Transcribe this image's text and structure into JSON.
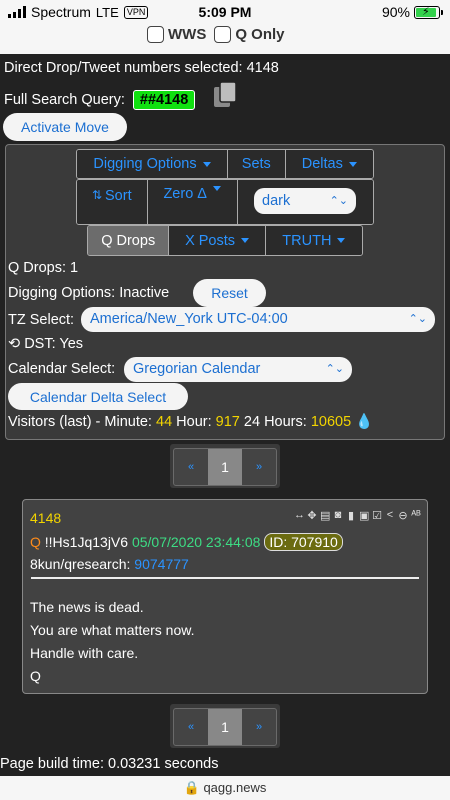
{
  "status": {
    "carrier": "Spectrum",
    "network": "LTE",
    "vpn": "VPN",
    "time": "5:09 PM",
    "battery": "90%",
    "battery_level": 0.9
  },
  "filters": {
    "wws": "WWS",
    "q_only": "Q Only"
  },
  "selection": {
    "text": "Direct Drop/Tweet numbers selected: 4148",
    "query_label": "Full Search Query:",
    "query_value": "##4148",
    "activate_move": "Activate Move"
  },
  "toolbar": {
    "digging": "Digging Options",
    "sets": "Sets",
    "deltas": "Deltas",
    "sort": "Sort",
    "zero": "Zero Δ",
    "theme": "dark",
    "q_drops": "Q Drops",
    "x_posts": "X Posts",
    "truth": "TRUTH"
  },
  "info": {
    "q_drops_count": "Q Drops: 1",
    "digging_status": "Digging Options: Inactive",
    "reset": "Reset",
    "tz_label": "TZ Select:",
    "tz_value": "America/New_York UTC-04:00",
    "dst": "DST: Yes",
    "calendar_label": "Calendar Select:",
    "calendar_value": "Gregorian Calendar",
    "calendar_delta": "Calendar Delta Select",
    "visitors_label": "Visitors (last) - Minute:",
    "minute": "44",
    "hour_label": "Hour:",
    "hour": "917",
    "day_label": "24 Hours:",
    "day": "10605"
  },
  "pagination": {
    "prev": "«",
    "current": "1",
    "next": "»"
  },
  "drop": {
    "number": "4148",
    "q": "Q",
    "trip": "!!Hs1Jq13jV6",
    "datetime": "05/07/2020 23:44:08",
    "id": "ID: 707910",
    "board": "8kun/qresearch:",
    "post_number": "9074777",
    "lines": [
      "The news is dead.",
      "You are what matters now.",
      "Handle with care.",
      "Q"
    ],
    "icons": [
      "arrows-horizontal-icon",
      "move-icon",
      "document-icon",
      "vr-icon",
      "clipboard-icon",
      "clipboard-check-icon",
      "check-square-icon",
      "share-icon",
      "no-entry-icon",
      "translate-icon"
    ]
  },
  "footer": {
    "build_time": "Page build time: 0.03231 seconds",
    "url": "qagg.news"
  },
  "colors": {
    "accent_blue": "#2b93ff",
    "highlight_yellow": "#f2d400",
    "query_green": "#10e010",
    "date_green": "#3ddc84",
    "drop_orange": "#ff8c1a",
    "post_blue": "#2b93ff"
  }
}
